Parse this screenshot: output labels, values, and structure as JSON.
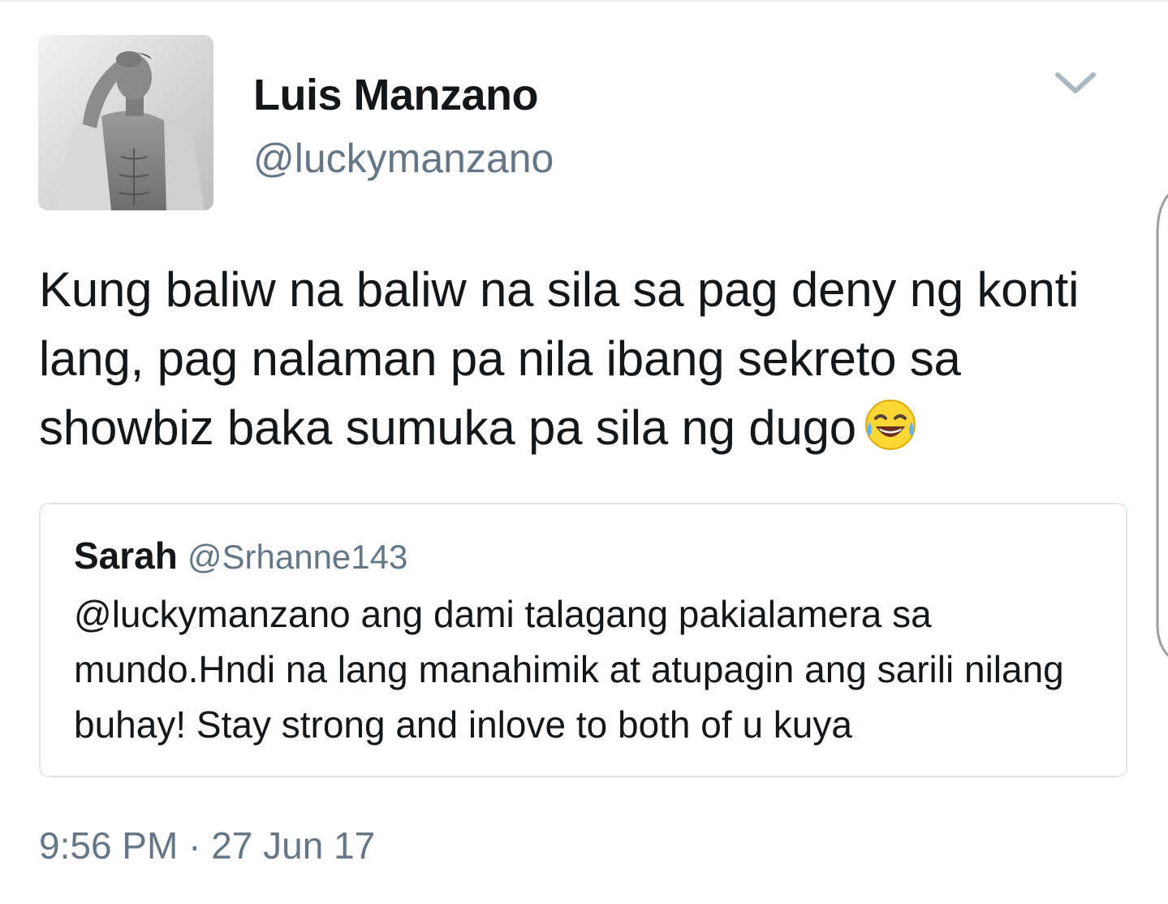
{
  "tweet": {
    "author": {
      "display_name": "Luis Manzano",
      "handle": "@luckymanzano",
      "avatar_icon": "profile-photo"
    },
    "menu_icon": "chevron-down-icon",
    "text": "Kung baliw na baliw na sila sa pag deny ng konti lang, pag nalaman pa nila ibang sekreto sa showbiz baka sumuka pa sila ng dugo",
    "emoji": "face-with-tears-of-joy",
    "timestamp": "9:56 PM · 27 Jun 17"
  },
  "quoted_tweet": {
    "display_name": "Sarah",
    "handle": "@Srhanne143",
    "text": "@luckymanzano ang dami talagang pakialamera sa mundo.Hndi na lang manahimik at atupagin ang sarili nilang buhay! Stay strong and inlove to both of u kuya"
  },
  "colors": {
    "primary_text": "#14171a",
    "secondary_text": "#657786",
    "border": "#e1e8ed",
    "chevron": "#aab8c2"
  }
}
